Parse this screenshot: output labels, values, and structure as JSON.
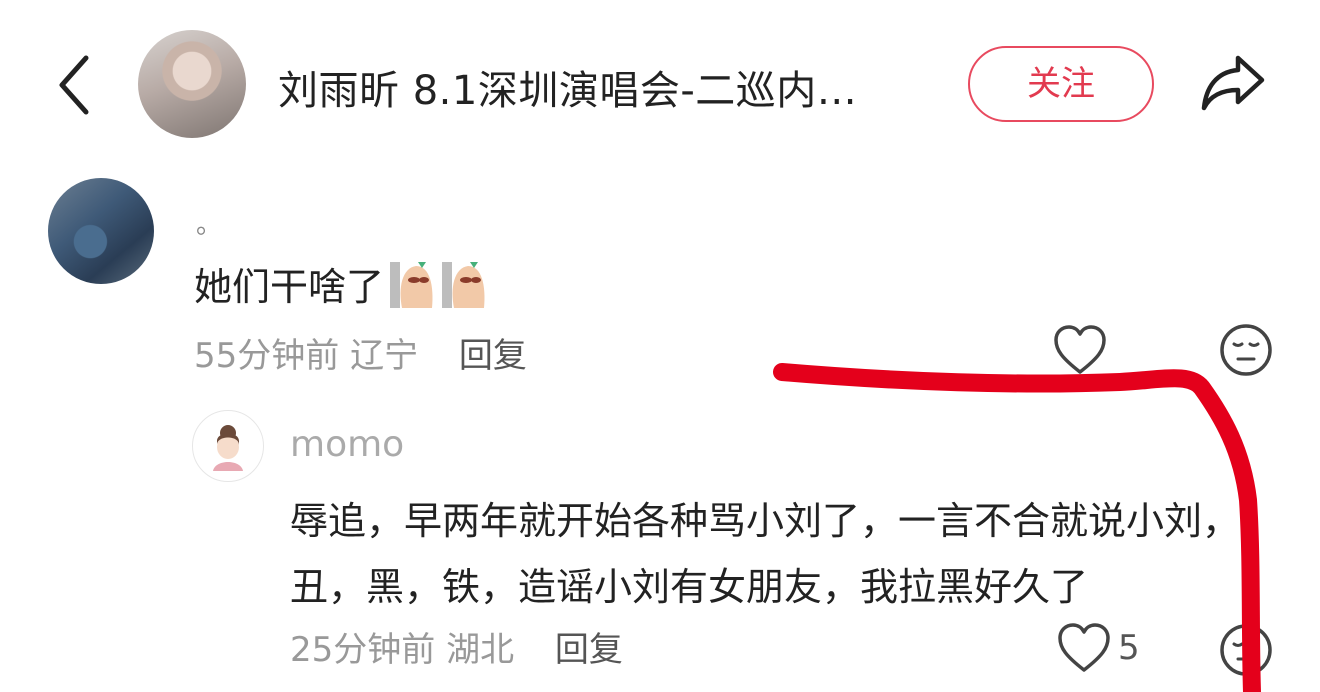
{
  "header": {
    "title": "刘雨昕 8.1深圳演唱会-二巡内…",
    "follow_label": "关注"
  },
  "comment": {
    "username": "。",
    "text": "她们干啥了",
    "time": "55分钟前",
    "location": "辽宁",
    "reply_label": "回复"
  },
  "reply": {
    "username": "momo",
    "text": "辱追，早两年就开始各种骂小刘了，一言不合就说小刘，丑，黑，铁，造谣小刘有女朋友，我拉黑好久了",
    "time": "25分钟前",
    "location": "湖北",
    "reply_label": "回复",
    "like_count": "5"
  },
  "annotation": {
    "color": "#e4001b"
  }
}
